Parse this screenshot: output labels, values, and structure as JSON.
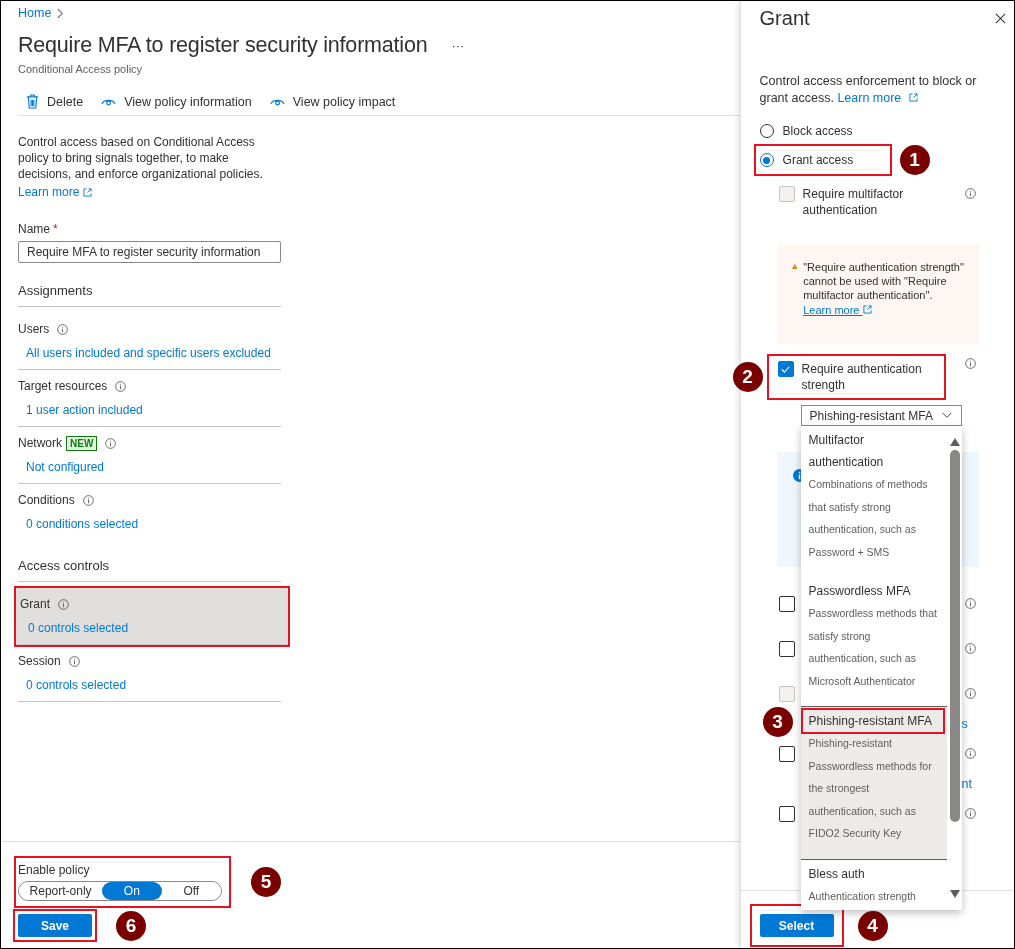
{
  "breadcrumb": {
    "label": "Home"
  },
  "page": {
    "title": "Require MFA to register security information",
    "more": "···",
    "subtitle": "Conditional Access policy"
  },
  "toolbar": [
    {
      "label": "Delete"
    },
    {
      "label": "View policy information"
    },
    {
      "label": "View policy impact"
    }
  ],
  "description": {
    "text": "Control access based on Conditional Access policy to bring signals together, to make decisions, and enforce organizational policies.",
    "link": "Learn more"
  },
  "name_field": {
    "label": "Name",
    "required_mark": "*",
    "value": "Require MFA to register security information"
  },
  "assignments": {
    "title": "Assignments",
    "items": [
      {
        "label": "Users",
        "value": "All users included and specific users excluded",
        "selected": false
      },
      {
        "label": "Target resources",
        "value": "1 user action included",
        "selected": false
      },
      {
        "label": "Network",
        "badge": "NEW",
        "value": "Not configured",
        "selected": false
      },
      {
        "label": "Conditions",
        "value": "0 conditions selected",
        "selected": false
      }
    ]
  },
  "access_controls": {
    "title": "Access controls",
    "items": [
      {
        "label": "Grant",
        "value": "0 controls selected",
        "selected": true,
        "annotated": true
      },
      {
        "label": "Session",
        "value": "0 controls selected",
        "selected": false,
        "annotated": false
      }
    ]
  },
  "enable_policy": {
    "label": "Enable policy",
    "annotated": true,
    "marker": "5",
    "options": [
      {
        "label": "Report-only",
        "selected": false
      },
      {
        "label": "On",
        "selected": true
      },
      {
        "label": "Off",
        "selected": false
      }
    ]
  },
  "save_button": {
    "label": "Save",
    "annotated": true,
    "marker": "6"
  },
  "grant_panel": {
    "title": "Grant",
    "description": "Control access enforcement to block or grant access.",
    "link": "Learn more",
    "access_options": [
      {
        "label": "Block access",
        "selected": false,
        "annotated": false
      },
      {
        "label": "Grant access",
        "selected": true,
        "annotated": true,
        "marker": "1"
      }
    ],
    "controls": [
      {
        "kind": "checkbox",
        "label": "Require multifactor authentication",
        "checked": false,
        "disabled": true,
        "annotated": false
      },
      {
        "kind": "warning",
        "text": "\"Require authentication strength\" cannot be used with \"Require multifactor authentication\".",
        "link": "Learn more"
      },
      {
        "kind": "checkbox",
        "label": "Require authentication strength",
        "checked": true,
        "disabled": false,
        "annotated": true,
        "marker": "2",
        "select": "Phishing-resistant MFA"
      },
      {
        "kind": "info"
      },
      {
        "kind": "checkbox",
        "checked": false,
        "disabled": false,
        "annotated": false
      },
      {
        "kind": "checkbox",
        "checked": false,
        "disabled": false,
        "annotated": false
      },
      {
        "kind": "checkbox",
        "checked": false,
        "disabled": true,
        "annotated": false
      },
      {
        "kind": "link",
        "text": "s"
      },
      {
        "kind": "checkbox",
        "checked": false,
        "disabled": false,
        "annotated": false
      },
      {
        "kind": "link",
        "text": "nt"
      },
      {
        "kind": "checkbox",
        "checked": false,
        "disabled": false,
        "annotated": false
      }
    ],
    "dropdown_options": [
      {
        "title": "Multifactor authentication",
        "description": "Combinations of methods that satisfy strong authentication, such as Password + SMS",
        "selected": false,
        "annotated": false
      },
      {
        "title": "Passwordless MFA",
        "description": "Passwordless methods that satisfy strong authentication, such as Microsoft Authenticator",
        "selected": false,
        "annotated": false
      },
      {
        "title": "Phishing-resistant MFA",
        "description": "Phishing-resistant Passwordless methods for the strongest authentication, such as FIDO2 Security Key",
        "selected": true,
        "annotated": true,
        "marker": "3"
      },
      {
        "title": "Bless auth",
        "description": "Authentication strength",
        "selected": false,
        "annotated": false
      }
    ],
    "select_button": {
      "label": "Select",
      "annotated": true,
      "marker": "4"
    }
  }
}
